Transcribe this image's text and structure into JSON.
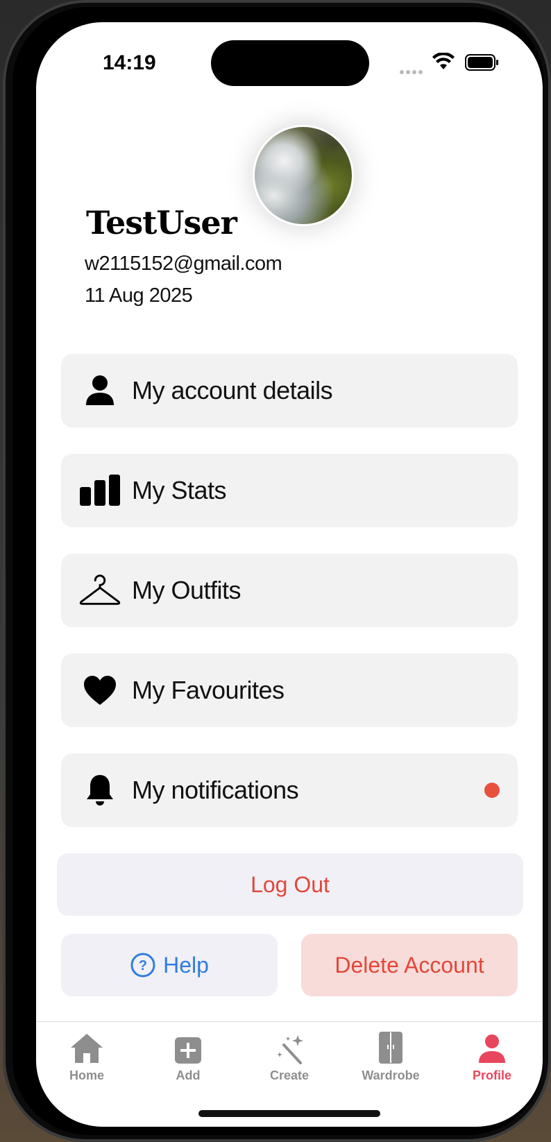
{
  "status_bar": {
    "time": "14:19"
  },
  "profile": {
    "username": "TestUser",
    "email": "w2115152@gmail.com",
    "joined": "11 Aug 2025"
  },
  "menu": [
    {
      "label": "My account details",
      "icon": "person-icon"
    },
    {
      "label": "My Stats",
      "icon": "bar-chart-icon"
    },
    {
      "label": "My Outfits",
      "icon": "hanger-icon"
    },
    {
      "label": "My Favourites",
      "icon": "heart-icon"
    },
    {
      "label": "My notifications",
      "icon": "bell-icon"
    }
  ],
  "actions": {
    "logout": "Log Out",
    "help": "Help",
    "delete": "Delete Account"
  },
  "tabs": [
    {
      "label": "Home",
      "icon": "house-icon"
    },
    {
      "label": "Add",
      "icon": "plus-square-icon"
    },
    {
      "label": "Create",
      "icon": "magic-wand-icon"
    },
    {
      "label": "Wardrobe",
      "icon": "wardrobe-icon"
    },
    {
      "label": "Profile",
      "icon": "person-icon",
      "active": true
    }
  ],
  "colors": {
    "accent_red": "#e2473b",
    "accent_blue": "#2f7de1",
    "active_tab": "#e8465e",
    "notification_dot": "#e8503e"
  }
}
